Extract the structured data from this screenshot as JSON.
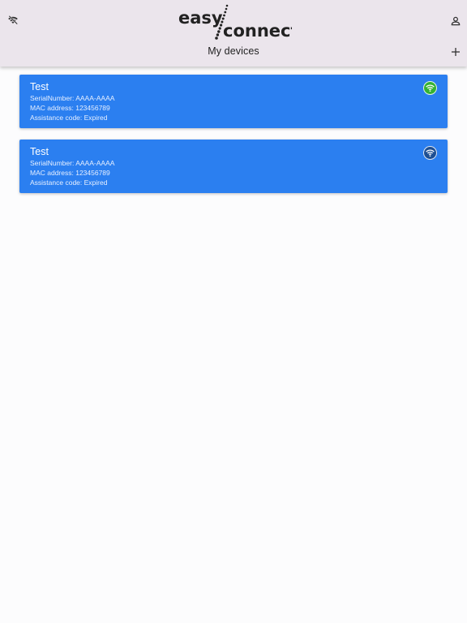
{
  "header": {
    "logo": {
      "part1": "easy",
      "part2": "connect"
    },
    "title": "My devices",
    "left_icon": "wifi-off-icon",
    "right_icon": "account-icon",
    "add_icon": "plus-icon"
  },
  "colors": {
    "header_bg": "#ebe5ec",
    "card_bg": "#2b7ff0",
    "status_online": "#34b233",
    "status_offline": "#1d4f93"
  },
  "devices": [
    {
      "name": "Test",
      "serial": "SerialNumber: AAAA-AAAA",
      "mac": "MAC address: 123456789",
      "assistance": "Assistance code: Expired",
      "status_icon": "wifi-online-icon"
    },
    {
      "name": "Test",
      "serial": "SerialNumber: AAAA-AAAA",
      "mac": "MAC address: 123456789",
      "assistance": "Assistance code: Expired",
      "status_icon": "wifi-offline-icon"
    }
  ]
}
